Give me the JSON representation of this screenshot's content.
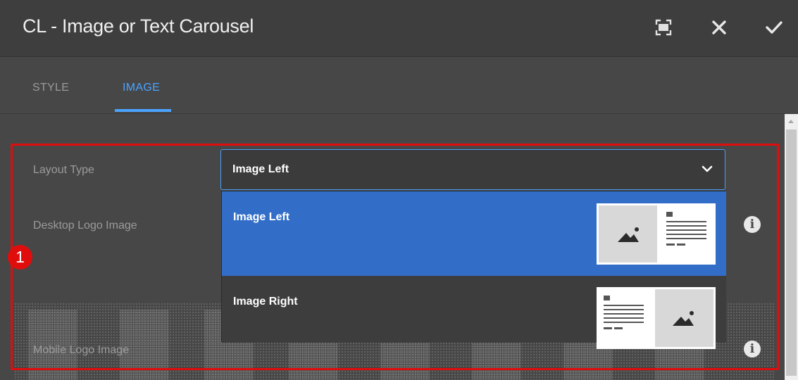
{
  "dialog": {
    "title": "CL - Image or Text Carousel"
  },
  "header_icons": [
    "fullscreen-icon",
    "close-icon",
    "checkmark-icon"
  ],
  "tabs": [
    {
      "label": "STYLE",
      "active": false
    },
    {
      "label": "IMAGE",
      "active": true
    }
  ],
  "form": {
    "layout_type_label": "Layout Type",
    "layout_type_value": "Image Left",
    "desktop_logo_label": "Desktop Logo Image",
    "mobile_logo_label": "Mobile Logo Image"
  },
  "dropdown": {
    "options": [
      {
        "label": "Image Left",
        "selected": true
      },
      {
        "label": "Image Right",
        "selected": false
      }
    ]
  },
  "annotation": {
    "badge_number": "1"
  },
  "colors": {
    "accent": "#4aa3ff",
    "selected_option": "#326ec8",
    "highlight": "#e00d0d"
  }
}
